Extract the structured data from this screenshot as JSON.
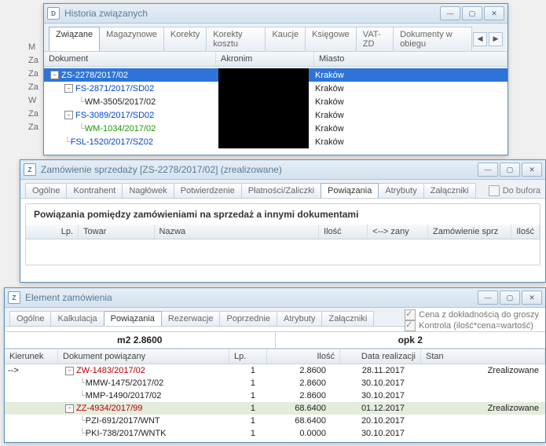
{
  "left_rows": [
    "M",
    "Za",
    "Za",
    "Za",
    "W",
    "Za",
    "Za"
  ],
  "win1": {
    "icon_letter": "D",
    "title": "Historia związanych",
    "tabs": [
      "Związane",
      "Magazynowe",
      "Korekty",
      "Korekty kosztu",
      "Kaucje",
      "Księgowe",
      "VAT-ZD",
      "Dokumenty w obiegu"
    ],
    "active_tab": 0,
    "cols": {
      "doc": "Dokument",
      "acronym": "Akronim",
      "city": "Miasto"
    },
    "rows": [
      {
        "indent": 0,
        "toggle": "−",
        "text": "ZS-2278/2017/02",
        "cls": "sel",
        "city": "Kraków",
        "link": "red",
        "masked": true
      },
      {
        "indent": 1,
        "toggle": "−",
        "text": "FS-2871/2017/SD02",
        "city": "Kraków",
        "link": "blue",
        "masked": true
      },
      {
        "indent": 2,
        "toggle": "",
        "text": "WM-3505/2017/02",
        "city": "Kraków",
        "link": "",
        "masked": true
      },
      {
        "indent": 1,
        "toggle": "−",
        "text": "FS-3089/2017/SD02",
        "city": "Kraków",
        "link": "blue",
        "masked": true
      },
      {
        "indent": 2,
        "toggle": "",
        "text": "WM-1034/2017/02",
        "city": "Kraków",
        "link": "green",
        "masked": true
      },
      {
        "indent": 1,
        "toggle": "",
        "text": "FSL-1520/2017/SZ02",
        "city": "Kraków",
        "link": "blue",
        "masked": true
      }
    ]
  },
  "win2": {
    "icon_letter": "Z",
    "title": "Zamówienie sprzedaży [ZS-2278/2017/02]  (zrealizowane)",
    "tabs": [
      "Ogólne",
      "Kontrahent",
      "Nagłówek",
      "Potwierdzenie",
      "Płatności/Zaliczki",
      "Powiązania",
      "Atrybuty",
      "Załączniki"
    ],
    "active_tab": 5,
    "bufor_label": "Do bufora",
    "heading": "Powiązania pomiędzy zamówieniami na sprzedaż a innymi dokumentami",
    "cols": {
      "lp": "Lp.",
      "towar": "Towar",
      "nazwa": "Nazwa",
      "ilosc": "Ilość",
      "zany": "<--> zany",
      "sprz": "Zamówienie sprz",
      "ilosc2": "Ilość"
    }
  },
  "win3": {
    "icon_letter": "Z",
    "title": "Element zamówienia",
    "check1": "Cena z dokładnością do groszy",
    "check2": "Kontrola (ilość*cena=wartość)",
    "tabs": [
      "Ogólne",
      "Kalkulacja",
      "Powiązania",
      "Rezerwacje",
      "Poprzednie",
      "Atrybuty",
      "Załączniki"
    ],
    "active_tab": 2,
    "summary_left": "m2 2.8600",
    "summary_right": "opk 2",
    "cols": {
      "kier": "Kierunek",
      "doc": "Dokument powiązany",
      "lp": "Lp.",
      "ilosc": "Ilość",
      "data": "Data realizacji",
      "stan": "Stan"
    },
    "arrow": "-->",
    "rows": [
      {
        "indent": 0,
        "toggle": "−",
        "text": "ZW-1483/2017/02",
        "lp": "1",
        "ilosc": "2.8600",
        "data": "28.11.2017",
        "stan": "Zrealizowane",
        "link": "red"
      },
      {
        "indent": 1,
        "toggle": "",
        "text": "MMW-1475/2017/02",
        "lp": "1",
        "ilosc": "2.8600",
        "data": "30.10.2017",
        "stan": "",
        "link": ""
      },
      {
        "indent": 1,
        "toggle": "",
        "text": "MMP-1490/2017/02",
        "lp": "1",
        "ilosc": "2.8600",
        "data": "30.10.2017",
        "stan": "",
        "link": ""
      },
      {
        "indent": 0,
        "toggle": "−",
        "text": "ZZ-4934/2017/99",
        "lp": "1",
        "ilosc": "68.6400",
        "data": "01.12.2017",
        "stan": "Zrealizowane",
        "link": "red",
        "sel": true
      },
      {
        "indent": 1,
        "toggle": "",
        "text": "PZI-691/2017/WNT",
        "lp": "1",
        "ilosc": "68.6400",
        "data": "20.10.2017",
        "stan": "",
        "link": ""
      },
      {
        "indent": 1,
        "toggle": "",
        "text": "PKI-738/2017/WNTK",
        "lp": "1",
        "ilosc": "0.0000",
        "data": "30.10.2017",
        "stan": "",
        "link": ""
      }
    ]
  }
}
